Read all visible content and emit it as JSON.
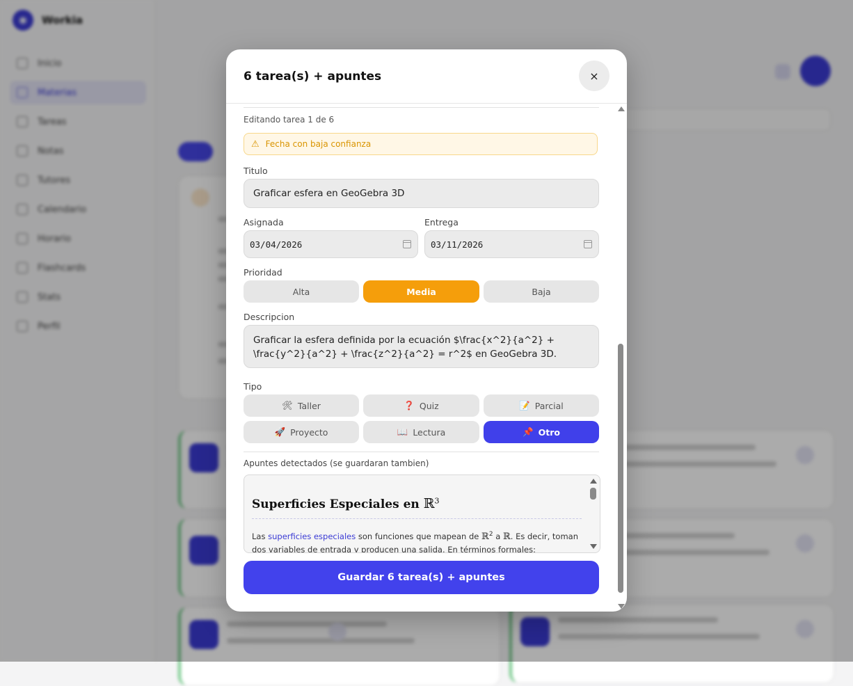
{
  "background": {
    "app_name": "Workia",
    "nav_items": [
      "Inicio",
      "Materias",
      "Tareas",
      "Notas",
      "Tutores",
      "Calendario",
      "Horario",
      "Flashcards",
      "Stats",
      "Perfil"
    ]
  },
  "modal": {
    "title": "6 tarea(s) + apuntes",
    "close_icon": "×",
    "editing_label": "Editando tarea 1 de 6",
    "warning": {
      "icon": "⚠",
      "text": "Fecha con baja confianza"
    },
    "title_label": "Titulo",
    "title_value": "Graficar esfera en GeoGebra 3D",
    "assigned_label": "Asignada",
    "assigned_value": "03/04/2026",
    "due_label": "Entrega",
    "due_value": "03/11/2026",
    "priority_label": "Prioridad",
    "priority_options": [
      "Alta",
      "Media",
      "Baja"
    ],
    "priority_selected": "Media",
    "description_label": "Descripcion",
    "description_value": "Graficar la esfera definida por la ecuación $\\frac{x^2}{a^2} + \\frac{y^2}{a^2} + \\frac{z^2}{a^2} = r^2$ en GeoGebra 3D.",
    "type_label": "Tipo",
    "type_options": [
      {
        "icon": "🛠",
        "label": "Taller"
      },
      {
        "icon": "❓",
        "label": "Quiz"
      },
      {
        "icon": "📝",
        "label": "Parcial"
      },
      {
        "icon": "🚀",
        "label": "Proyecto"
      },
      {
        "icon": "📖",
        "label": "Lectura"
      },
      {
        "icon": "📌",
        "label": "Otro"
      }
    ],
    "type_selected": "Otro",
    "notes_label": "Apuntes detectados (se guardaran tambien)",
    "notes": {
      "heading": "Superficies Especiales en",
      "heading_symbol": "ℝ",
      "heading_exp": "3",
      "p_prefix": "Las ",
      "p_link": "superficies especiales",
      "p_mid": " son funciones que mapean de ",
      "p_sym1": "ℝ",
      "p_exp1": "2",
      "p_a": " a ",
      "p_sym2": "ℝ",
      "p_suffix": ". Es decir, toman dos variables de entrada y producen una salida. En términos formales:"
    },
    "save_label": "Guardar 6 tarea(s) + apuntes"
  },
  "colors": {
    "accent": "#4242ec",
    "priority_selected": "#f59e0b",
    "warning": "#d99400"
  }
}
